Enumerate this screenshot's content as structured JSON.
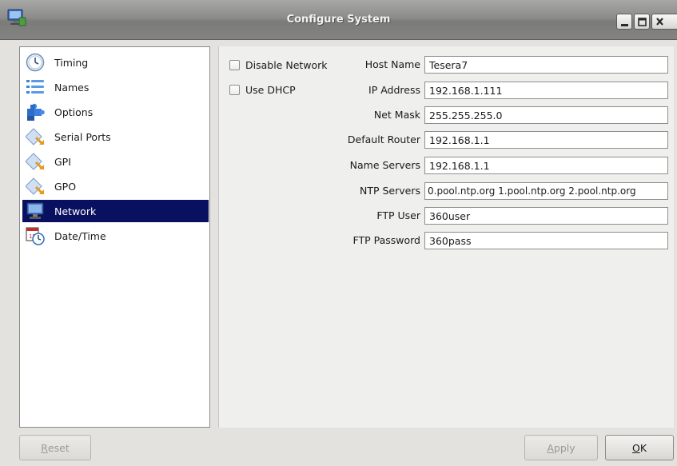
{
  "window": {
    "title": "Configure System",
    "icon": "network-computer-icon"
  },
  "titlebar_buttons": {
    "minimize": "minimize-icon",
    "maximize": "maximize-icon",
    "close": "close-icon"
  },
  "sidebar": {
    "selected": "Network",
    "items": [
      {
        "label": "Timing",
        "icon": "clock-icon"
      },
      {
        "label": "Names",
        "icon": "list-icon"
      },
      {
        "label": "Options",
        "icon": "puzzle-icon"
      },
      {
        "label": "Serial Ports",
        "icon": "diamond-arrow-icon"
      },
      {
        "label": "GPI",
        "icon": "diamond-arrow-icon"
      },
      {
        "label": "GPO",
        "icon": "diamond-arrow-icon"
      },
      {
        "label": "Network",
        "icon": "monitor-icon"
      },
      {
        "label": "Date/Time",
        "icon": "calendar-clock-icon"
      }
    ]
  },
  "network": {
    "checkboxes": [
      {
        "label": "Disable Network",
        "checked": false
      },
      {
        "label": "Use DHCP",
        "checked": false
      }
    ],
    "fields": [
      {
        "label": "Host Name",
        "value": "Tesera7"
      },
      {
        "label": "IP Address",
        "value": "192.168.1.111"
      },
      {
        "label": "Net Mask",
        "value": "255.255.255.0"
      },
      {
        "label": "Default Router",
        "value": "192.168.1.1"
      },
      {
        "label": "Name Servers",
        "value": "192.168.1.1"
      },
      {
        "label": "NTP Servers",
        "value": "0.pool.ntp.org 1.pool.ntp.org 2.pool.ntp.org"
      },
      {
        "label": "FTP User",
        "value": "360user"
      },
      {
        "label": "FTP Password",
        "value": "360pass"
      }
    ]
  },
  "buttons": {
    "reset": {
      "label_first": "R",
      "label_rest": "eset",
      "enabled": false
    },
    "apply": {
      "label_first": "A",
      "label_rest": "pply",
      "enabled": false
    },
    "ok": {
      "label_first": "O",
      "label_rest": "K",
      "enabled": true
    }
  },
  "colors": {
    "selection": "#0a1060",
    "titlebar": "#8c8c8a"
  }
}
